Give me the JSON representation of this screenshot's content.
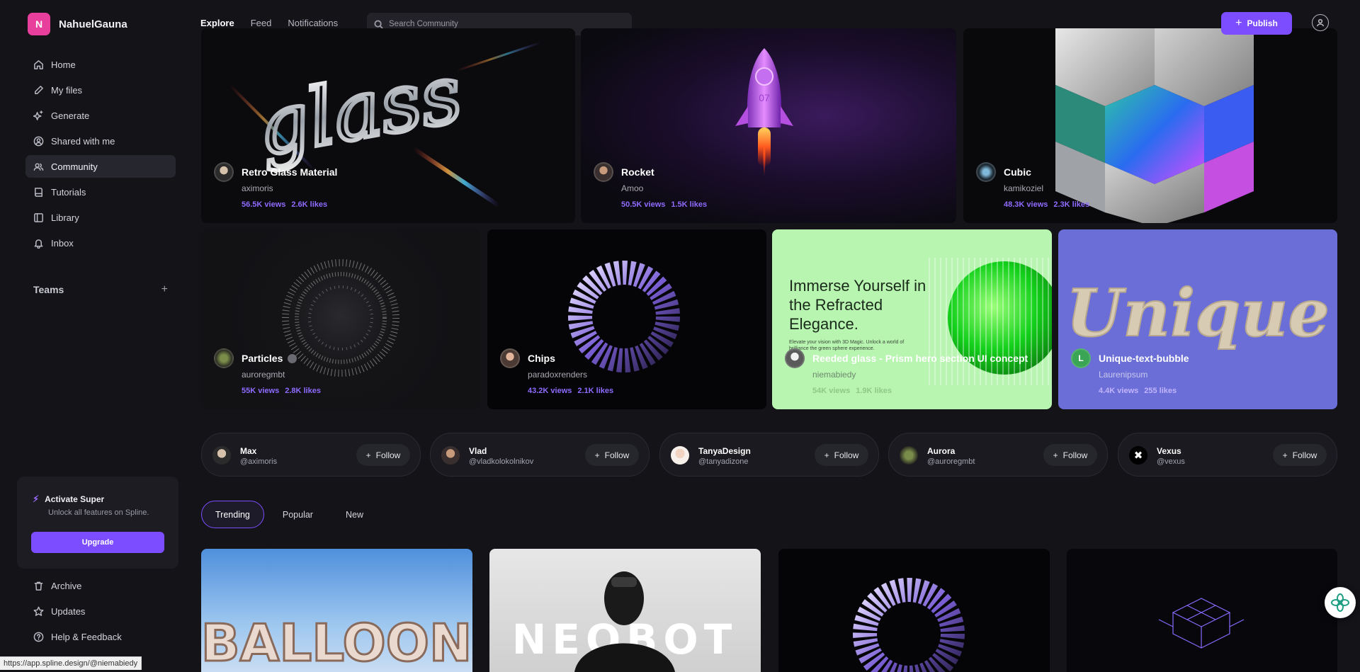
{
  "workspace": {
    "initial": "N",
    "name": "NahuelGauna"
  },
  "sidebar": {
    "items": [
      {
        "label": "Home",
        "icon": "home-icon"
      },
      {
        "label": "My files",
        "icon": "pencil-icon"
      },
      {
        "label": "Generate",
        "icon": "sparkle-icon"
      },
      {
        "label": "Shared with me",
        "icon": "user-circle-icon"
      },
      {
        "label": "Community",
        "icon": "users-icon",
        "active": true
      },
      {
        "label": "Tutorials",
        "icon": "book-icon"
      },
      {
        "label": "Library",
        "icon": "library-icon"
      },
      {
        "label": "Inbox",
        "icon": "bell-icon"
      }
    ],
    "teams_label": "Teams",
    "teams_add": "+",
    "promo": {
      "title": "Activate Super",
      "subtitle": "Unlock all features on Spline.",
      "button": "Upgrade"
    },
    "bottom_items": [
      {
        "label": "Archive",
        "icon": "trash-icon"
      },
      {
        "label": "Updates",
        "icon": "star-icon"
      },
      {
        "label": "Help & Feedback",
        "icon": "help-icon"
      }
    ]
  },
  "topbar": {
    "tabs": [
      "Explore",
      "Feed",
      "Notifications"
    ],
    "active_tab": "Explore",
    "search_placeholder": "Search Community",
    "publish_label": "Publish"
  },
  "featured": [
    {
      "title": "Retro Glass Material",
      "author": "aximoris",
      "views": "56.5K views",
      "likes": "2.6K likes"
    },
    {
      "title": "Rocket",
      "author": "Amoo",
      "views": "50.5K views",
      "likes": "1.5K likes"
    },
    {
      "title": "Cubic",
      "author": "kamikoziel",
      "views": "48.3K views",
      "likes": "2.3K likes"
    },
    {
      "title": "Particles",
      "author": "auroregmbt",
      "views": "55K views",
      "likes": "2.8K likes"
    },
    {
      "title": "Chips",
      "author": "paradoxrenders",
      "views": "43.2K views",
      "likes": "2.1K likes"
    },
    {
      "title": "Reeded glass - Prism hero section UI concept",
      "author": "niemabiedy",
      "views": "54K views",
      "likes": "1.9K likes",
      "art_heading": "Immerse Yourself in the Refracted Elegance.",
      "art_sub": "Elevate your vision with 3D Magic. Unlock a world of brilliance the green sphere experience."
    },
    {
      "title": "Unique-text-bubble",
      "author": "Laurenipsum",
      "views": "4.4K views",
      "likes": "255 likes",
      "avatar_initial": "L"
    }
  ],
  "art_text": {
    "glass": "glass",
    "unique": "Unique",
    "balloon": "BALLOON",
    "neobot": "NEOBOT",
    "rocket_number": "07"
  },
  "creators": [
    {
      "name": "Max",
      "handle": "@aximoris",
      "follow": "Follow"
    },
    {
      "name": "Vlad",
      "handle": "@vladkolokolnikov",
      "follow": "Follow"
    },
    {
      "name": "TanyaDesign",
      "handle": "@tanyadizone",
      "follow": "Follow"
    },
    {
      "name": "Aurora",
      "handle": "@auroregmbt",
      "follow": "Follow"
    },
    {
      "name": "Vexus",
      "handle": "@vexus",
      "follow": "Follow"
    }
  ],
  "filters": [
    "Trending",
    "Popular",
    "New"
  ],
  "active_filter": "Trending",
  "status_url": "https://app.spline.design/@niemabiedy",
  "colors": {
    "accent": "#7c4dff",
    "background": "#131318",
    "card": "#1a1a20"
  }
}
